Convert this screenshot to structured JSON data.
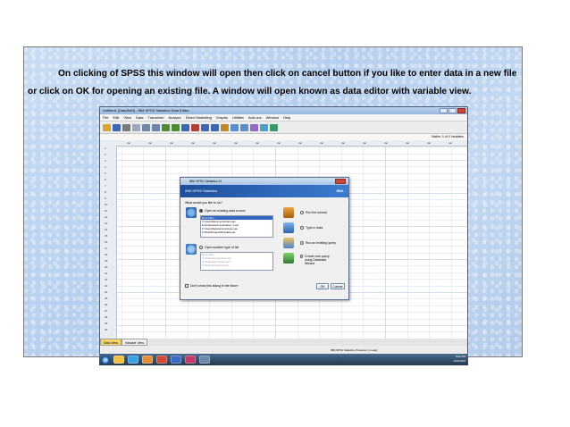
{
  "caption": "On clicking of SPSS this window will open then click on cancel button if you like to enter data in a new file or click on OK for opening an existing file. A window will open known as data editor with variable view.",
  "spss": {
    "title": "Untitled1 [DataSet0] - IBM SPSS Statistics Data Editor",
    "menus": [
      "File",
      "Edit",
      "View",
      "Data",
      "Transform",
      "Analyze",
      "Direct Marketing",
      "Graphs",
      "Utilities",
      "Add-ons",
      "Window",
      "Help"
    ],
    "visible_vars": "Visible: 0 of 0 Variables",
    "col_header": "var",
    "rows": [
      "1",
      "2",
      "3",
      "4",
      "5",
      "6",
      "7",
      "8",
      "9",
      "10",
      "11",
      "12",
      "13",
      "14",
      "15",
      "16",
      "17",
      "18",
      "19",
      "20",
      "21",
      "22",
      "23",
      "24",
      "25",
      "26",
      "27",
      "28",
      "29",
      "30"
    ],
    "tabs": {
      "data_view": "Data View",
      "variable_view": "Variable View"
    },
    "status": "IBM SPSS Statistics Processor is ready"
  },
  "dialog": {
    "title": "IBM SPSS Statistics 21",
    "banner": "IBM SPSS Statistics",
    "logo": "IBM.",
    "question": "What would you like to do?",
    "open_existing": "Open an existing data source",
    "recent_files": [
      "More Files...",
      "C:\\Users\\Documents\\Cars.sav",
      "E:\\Analysis\\survey\\dataset_4.sav",
      "C:\\Users\\Desktop\\employee.sav",
      "F:\\Work\\Project\\2014\\data.sav"
    ],
    "open_other": "Open another type of file",
    "other_files": [
      "More Files...",
      "C:\\Analysis\\output\\ans.spv",
      "C:\\Analysis\\corr\\table.spv",
      "C:\\Analysis\\ref\\descr.spv"
    ],
    "run_tutorial": "Run the tutorial",
    "type_in_data": "Type in data",
    "run_existing_query": "Run an existing query",
    "create_query": "Create new query using Database Wizard",
    "dont_show": "Don't show this dialog in the future",
    "ok": "OK",
    "cancel": "Cancel"
  },
  "taskbar": {
    "time": "8:22 PM",
    "date": "4/22/2015"
  },
  "colors": {
    "slide_bg": "#c4d8f1",
    "banner": "#1e4f9a",
    "active_tab": "#f6d66a"
  }
}
